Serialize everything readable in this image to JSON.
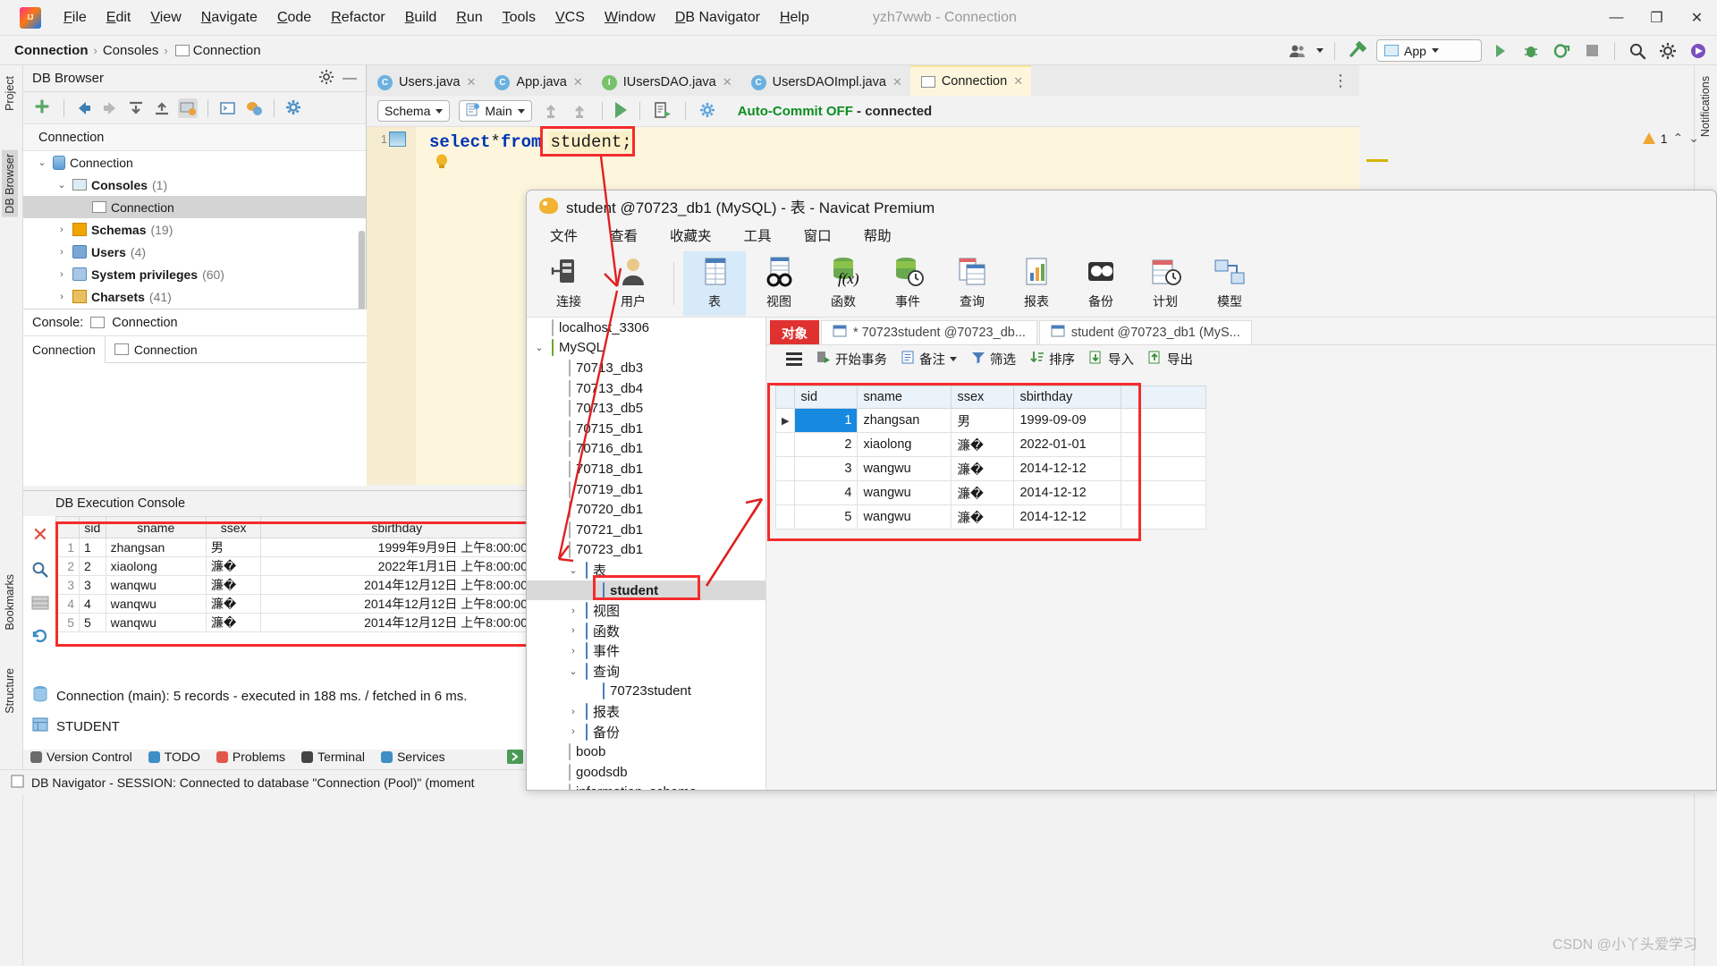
{
  "ide": {
    "window_title": "yzh7wwb - Connection",
    "menu": [
      "File",
      "Edit",
      "View",
      "Navigate",
      "Code",
      "Refactor",
      "Build",
      "Run",
      "Tools",
      "VCS",
      "Window",
      "DB Navigator",
      "Help"
    ],
    "window_controls": {
      "minimize": "—",
      "maximize": "❐",
      "close": "✕"
    },
    "breadcrumb": {
      "project": "Connection",
      "sep": "›",
      "consoles": "Consoles",
      "console": "Connection"
    },
    "run_config": "App",
    "left_strip": [
      "Project",
      "DB Browser"
    ],
    "left_strip_bottom": [
      "Bookmarks",
      "Structure"
    ],
    "right_strip": [
      "Notifications"
    ],
    "db_browser": {
      "title": "DB Browser",
      "connection_header": "Connection",
      "tree": [
        {
          "label": "Connection",
          "count": "",
          "indent": 0,
          "arrow": "⌄",
          "icon": "database-icon",
          "bold": false
        },
        {
          "label": "Consoles",
          "count": "(1)",
          "indent": 1,
          "arrow": "⌄",
          "icon": "consoles-icon",
          "bold": true
        },
        {
          "label": "Connection",
          "count": "",
          "indent": 2,
          "arrow": "",
          "icon": "console-icon",
          "bold": false,
          "selected": true
        },
        {
          "label": "Schemas",
          "count": "(19)",
          "indent": 1,
          "arrow": "›",
          "icon": "schema-icon",
          "bold": true
        },
        {
          "label": "Users",
          "count": "(4)",
          "indent": 1,
          "arrow": "›",
          "icon": "users-icon",
          "bold": true
        },
        {
          "label": "System privileges",
          "count": "(60)",
          "indent": 1,
          "arrow": "›",
          "icon": "privileges-icon",
          "bold": true
        },
        {
          "label": "Charsets",
          "count": "(41)",
          "indent": 1,
          "arrow": "›",
          "icon": "charset-icon",
          "bold": true
        }
      ],
      "console_label": "Console:",
      "console_value": "Connection",
      "console_tabs": [
        "Connection",
        "Connection"
      ]
    },
    "editor": {
      "tabs": [
        {
          "label": "Users.java",
          "icon": "class-icon",
          "selected": false
        },
        {
          "label": "App.java",
          "icon": "runnable-class-icon",
          "selected": false
        },
        {
          "label": "IUsersDAO.java",
          "icon": "interface-icon",
          "selected": false
        },
        {
          "label": "UsersDAOImpl.java",
          "icon": "class-icon",
          "selected": false
        },
        {
          "label": "Connection",
          "icon": "console-icon",
          "selected": true
        }
      ],
      "toolbar": {
        "schema": "Schema",
        "main": "Main",
        "auto_commit": "Auto-Commit OFF",
        "connected": "- connected"
      },
      "line_number": "1",
      "sql_keyword": "select",
      "sql_star": " * ",
      "sql_from": "from",
      "sql_table": "student;",
      "warning_count": "1"
    },
    "exec_console": {
      "title": "DB Execution Console",
      "columns": [
        "sid",
        "sname",
        "ssex",
        "sbirthday"
      ],
      "rows": [
        {
          "n": "1",
          "sid": "1",
          "sname": "zhangsan",
          "ssex": "男",
          "sbirthday": "1999年9月9日 上午8:00:00"
        },
        {
          "n": "2",
          "sid": "2",
          "sname": "xiaolong",
          "ssex": "濂�",
          "sbirthday": "2022年1月1日 上午8:00:00"
        },
        {
          "n": "3",
          "sid": "3",
          "sname": "wanqwu",
          "ssex": "濂�",
          "sbirthday": "2014年12月12日 上午8:00:00"
        },
        {
          "n": "4",
          "sid": "4",
          "sname": "wanqwu",
          "ssex": "濂�",
          "sbirthday": "2014年12月12日 上午8:00:00"
        },
        {
          "n": "5",
          "sid": "5",
          "sname": "wanqwu",
          "ssex": "濂�",
          "sbirthday": "2014年12月12日 上午8:00:00"
        }
      ],
      "status": "Connection (main): 5 records  - executed in 188 ms. / fetched in 6 ms.",
      "table_name": "STUDENT"
    },
    "bottom_tabs": [
      "Version Control",
      "TODO",
      "Problems",
      "Terminal",
      "Services"
    ],
    "status_text": "DB Navigator - SESSION: Connected to database \"Connection (Pool)\" (moment"
  },
  "navicat": {
    "title": "student @70723_db1 (MySQL) - 表 - Navicat Premium",
    "menu": [
      "文件",
      "查看",
      "收藏夹",
      "工具",
      "窗口",
      "帮助"
    ],
    "ribbon": [
      {
        "label": "连接",
        "icon": "connection-icon",
        "selected": false
      },
      {
        "label": "用户",
        "icon": "user-icon",
        "selected": false
      },
      {
        "label": "表",
        "icon": "table-icon",
        "selected": true
      },
      {
        "label": "视图",
        "icon": "view-icon",
        "selected": false
      },
      {
        "label": "函数",
        "icon": "function-icon",
        "selected": false
      },
      {
        "label": "事件",
        "icon": "event-icon",
        "selected": false
      },
      {
        "label": "查询",
        "icon": "query-icon",
        "selected": false
      },
      {
        "label": "报表",
        "icon": "report-icon",
        "selected": false
      },
      {
        "label": "备份",
        "icon": "backup-icon",
        "selected": false
      },
      {
        "label": "计划",
        "icon": "schedule-icon",
        "selected": false
      },
      {
        "label": "模型",
        "icon": "model-icon",
        "selected": false
      }
    ],
    "tree": [
      {
        "label": "localhost_3306",
        "indent": 0,
        "arrow": "",
        "icon": "server-icon"
      },
      {
        "label": "MySQL",
        "indent": 0,
        "arrow": "⌄",
        "icon": "mysql-icon"
      },
      {
        "label": "70713_db3",
        "indent": 1,
        "arrow": "",
        "icon": "db-icon"
      },
      {
        "label": "70713_db4",
        "indent": 1,
        "arrow": "",
        "icon": "db-icon"
      },
      {
        "label": "70713_db5",
        "indent": 1,
        "arrow": "",
        "icon": "db-icon"
      },
      {
        "label": "70715_db1",
        "indent": 1,
        "arrow": "",
        "icon": "db-icon"
      },
      {
        "label": "70716_db1",
        "indent": 1,
        "arrow": "",
        "icon": "db-icon"
      },
      {
        "label": "70718_db1",
        "indent": 1,
        "arrow": "",
        "icon": "db-icon"
      },
      {
        "label": "70719_db1",
        "indent": 1,
        "arrow": "",
        "icon": "db-icon"
      },
      {
        "label": "70720_db1",
        "indent": 1,
        "arrow": "",
        "icon": "db-icon"
      },
      {
        "label": "70721_db1",
        "indent": 1,
        "arrow": "",
        "icon": "db-icon"
      },
      {
        "label": "70723_db1",
        "indent": 1,
        "arrow": "",
        "icon": "db-icon"
      },
      {
        "label": "表",
        "indent": 2,
        "arrow": "⌄",
        "icon": "tables-folder-icon"
      },
      {
        "label": "student",
        "indent": 3,
        "arrow": "",
        "icon": "table-leaf-icon",
        "selected": true
      },
      {
        "label": "视图",
        "indent": 2,
        "arrow": "›",
        "icon": "views-folder-icon"
      },
      {
        "label": "函数",
        "indent": 2,
        "arrow": "›",
        "icon": "functions-folder-icon"
      },
      {
        "label": "事件",
        "indent": 2,
        "arrow": "›",
        "icon": "events-folder-icon"
      },
      {
        "label": "查询",
        "indent": 2,
        "arrow": "⌄",
        "icon": "queries-folder-icon"
      },
      {
        "label": "70723student",
        "indent": 3,
        "arrow": "",
        "icon": "query-leaf-icon"
      },
      {
        "label": "报表",
        "indent": 2,
        "arrow": "›",
        "icon": "reports-folder-icon"
      },
      {
        "label": "备份",
        "indent": 2,
        "arrow": "›",
        "icon": "backups-folder-icon"
      },
      {
        "label": "boob",
        "indent": 1,
        "arrow": "",
        "icon": "db-icon"
      },
      {
        "label": "goodsdb",
        "indent": 1,
        "arrow": "",
        "icon": "db-icon"
      },
      {
        "label": "information_schema",
        "indent": 1,
        "arrow": "",
        "icon": "db-icon"
      }
    ],
    "tabs": [
      {
        "label": "对象",
        "icon": "object-icon",
        "active": true
      },
      {
        "label": "* 70723student @70723_db...",
        "icon": "query-tab-icon",
        "active": false
      },
      {
        "label": "student @70723_db1 (MyS...",
        "icon": "table-tab-icon",
        "active": false
      }
    ],
    "toolbar": [
      {
        "label": "开始事务",
        "icon": "begin-transaction-icon"
      },
      {
        "label": "备注",
        "icon": "note-icon",
        "caret": true
      },
      {
        "label": "筛选",
        "icon": "filter-icon"
      },
      {
        "label": "排序",
        "icon": "sort-icon"
      },
      {
        "label": "导入",
        "icon": "import-icon"
      },
      {
        "label": "导出",
        "icon": "export-icon"
      }
    ],
    "grid": {
      "columns": [
        "sid",
        "sname",
        "ssex",
        "sbirthday"
      ],
      "rows": [
        {
          "sid": "1",
          "sname": "zhangsan",
          "ssex": "男",
          "sbirthday": "1999-09-09"
        },
        {
          "sid": "2",
          "sname": "xiaolong",
          "ssex": "濂�",
          "sbirthday": "2022-01-01"
        },
        {
          "sid": "3",
          "sname": "wangwu",
          "ssex": "濂�",
          "sbirthday": "2014-12-12"
        },
        {
          "sid": "4",
          "sname": "wangwu",
          "ssex": "濂�",
          "sbirthday": "2014-12-12"
        },
        {
          "sid": "5",
          "sname": "wangwu",
          "ssex": "濂�",
          "sbirthday": "2014-12-12"
        }
      ]
    }
  },
  "watermark": "CSDN @小丫头爱学习",
  "colors": {
    "accent_red": "#f52c2c",
    "green": "#0a8f20",
    "navicat_red": "#e03131",
    "select_blue": "#1789e0"
  }
}
